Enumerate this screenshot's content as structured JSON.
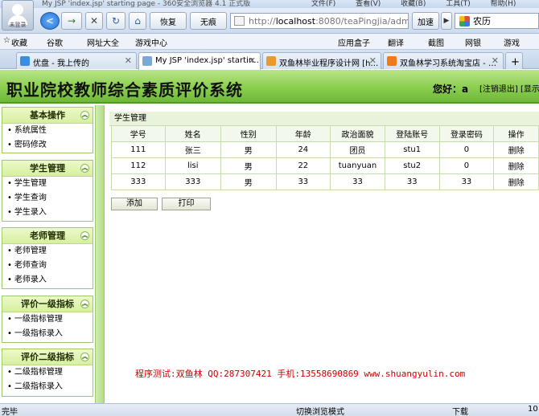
{
  "browser": {
    "window_title": "My JSP 'index.jsp' starting page - 360安全浏览器 4.1 正式版",
    "menus": [
      "文件(F)",
      "查看(V)",
      "收藏(B)",
      "工具(T)",
      "帮助(H)"
    ],
    "avatar_label": "未登录",
    "back_label": "<",
    "forward_label": "→",
    "stop_label": "✕",
    "reload_label": "↻",
    "home_label": "⌂",
    "restore_label": "恢复",
    "ad_label": "无痕",
    "url_host": "localhost",
    "url_rest": ":8080/teaPingjia/admin",
    "accelerate_label": "加速",
    "search_value": "农历",
    "favorites": [
      "收藏",
      "谷歌",
      "网址大全",
      "游戏中心",
      "应用盒子",
      "翻译",
      "截图",
      "网银",
      "游戏"
    ],
    "tabs": [
      {
        "title": "优盘 - 我上传的",
        "color": "#3b8de0",
        "active": false
      },
      {
        "title": "My JSP 'index.jsp' startin…",
        "color": "#7aa9d8",
        "active": true
      },
      {
        "title": "双鱼林毕业程序设计网 [h…",
        "color": "#e89a2c",
        "active": false
      },
      {
        "title": "双鱼林学习系统淘宝店 - …",
        "color": "#f07a1a",
        "active": false
      }
    ],
    "status_left": "完毕",
    "status_right": [
      "切换浏览模式",
      "下载"
    ],
    "zoom": "10"
  },
  "header": {
    "title": "职业院校教师综合素质评价系统",
    "greeting": "您好：a",
    "logout": "[注销退出] [显示主"
  },
  "sidebar": {
    "groups": [
      {
        "title": "基本操作",
        "items": [
          "系统属性",
          "密码修改"
        ]
      },
      {
        "title": "学生管理",
        "items": [
          "学生管理",
          "学生查询",
          "学生录入"
        ]
      },
      {
        "title": "老师管理",
        "items": [
          "老师管理",
          "老师查询",
          "老师录入"
        ]
      },
      {
        "title": "评价一级指标",
        "items": [
          "一级指标管理",
          "一级指标录入"
        ]
      },
      {
        "title": "评价二级指标",
        "items": [
          "二级指标管理",
          "二级指标录入"
        ]
      }
    ]
  },
  "main": {
    "section_title": "学生管理",
    "columns": [
      "学号",
      "姓名",
      "性别",
      "年龄",
      "政治面貌",
      "登陆账号",
      "登录密码",
      "操作"
    ],
    "rows": [
      [
        "111",
        "张三",
        "男",
        "24",
        "团员",
        "stu1",
        "0",
        "删除"
      ],
      [
        "112",
        "lisi",
        "男",
        "22",
        "tuanyuan",
        "stu2",
        "0",
        "删除"
      ],
      [
        "333",
        "333",
        "男",
        "33",
        "33",
        "33",
        "33",
        "删除"
      ]
    ],
    "add_label": "添加",
    "print_label": "打印",
    "footer_note": "程序测试:双鱼林 QQ:287307421 手机:13558690869 www.shuangyulin.com"
  }
}
